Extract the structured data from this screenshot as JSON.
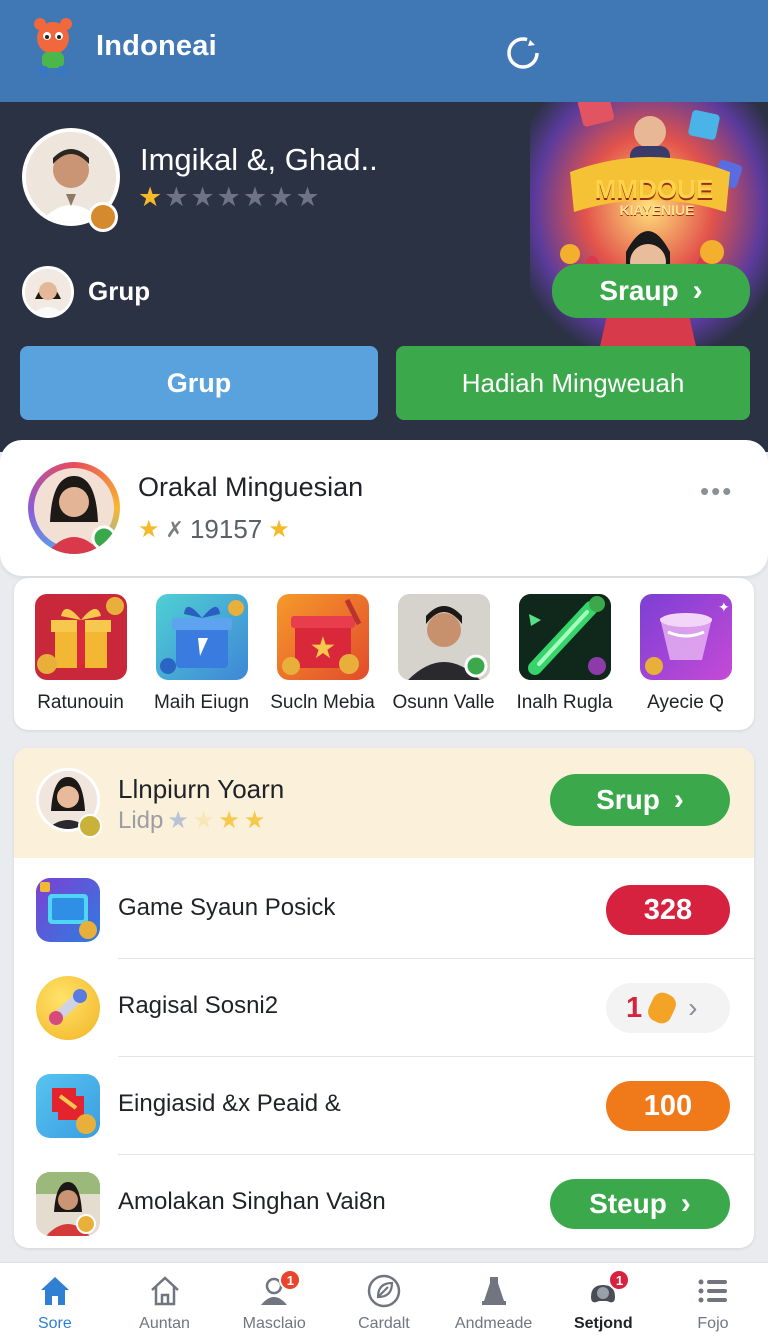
{
  "header": {
    "app_name": "Indoneai",
    "promo_title_line1": "MMDOUE",
    "promo_title_line2": "KIAYENIUE"
  },
  "hero": {
    "player_name": "Imgikal &, Ghad..",
    "rating": {
      "filled": 1,
      "total": 7
    },
    "group_label": "Grup",
    "sraup_button": "Sraup",
    "tab_grup": "Grup",
    "tab_hadiah": "Hadiah Mingweuah"
  },
  "profile_card": {
    "name": "Orakal Minguesian",
    "score": "19157"
  },
  "rewards": [
    {
      "label": "Ratunouin",
      "icon": "gift-box-icon"
    },
    {
      "label": "Maih Eiugn",
      "icon": "blue-gift-icon"
    },
    {
      "label": "Sucln Mebia",
      "icon": "red-star-box-icon"
    },
    {
      "label": "Osunn Valle",
      "icon": "player-portrait"
    },
    {
      "label": "Inalh Rugla",
      "icon": "green-wand-icon"
    },
    {
      "label": "Ayecie Q",
      "icon": "purple-cup-icon"
    }
  ],
  "challenge": {
    "title": "Llnpiurn Yoarn",
    "subtitle": "Lidp",
    "button": "Srup",
    "rows": [
      {
        "label": "Game Syaun Posick",
        "value": "328",
        "kind": "red"
      },
      {
        "label": "Ragisal Sosni2",
        "value": "1",
        "kind": "light"
      },
      {
        "label": "Eingiasid &x Peaid &",
        "value": "100",
        "kind": "orange"
      },
      {
        "label": "Amolakan Singhan Vai8n",
        "value": "Steup",
        "kind": "green"
      }
    ]
  },
  "bottom_nav": [
    {
      "label": "Sore",
      "icon": "home-icon",
      "active": true
    },
    {
      "label": "Auntan",
      "icon": "house-outline-icon"
    },
    {
      "label": "Masclaio",
      "icon": "chat-person-icon",
      "badge": "1"
    },
    {
      "label": "Cardalt",
      "icon": "leaf-circle-icon"
    },
    {
      "label": "Andmeade",
      "icon": "bell-tower-icon"
    },
    {
      "label": "Setjond",
      "icon": "gamepad-icon",
      "badge": "1",
      "strong": true
    },
    {
      "label": "Fojo",
      "icon": "menu-list-icon"
    }
  ],
  "colors": {
    "topbar": "#3f78b5",
    "hero_bg": "#2b3244",
    "green": "#3ba94b",
    "blue_tab": "#5aa2de",
    "red_pill": "#d7223f",
    "orange_pill": "#f07a1a",
    "star": "#f5b92a"
  }
}
